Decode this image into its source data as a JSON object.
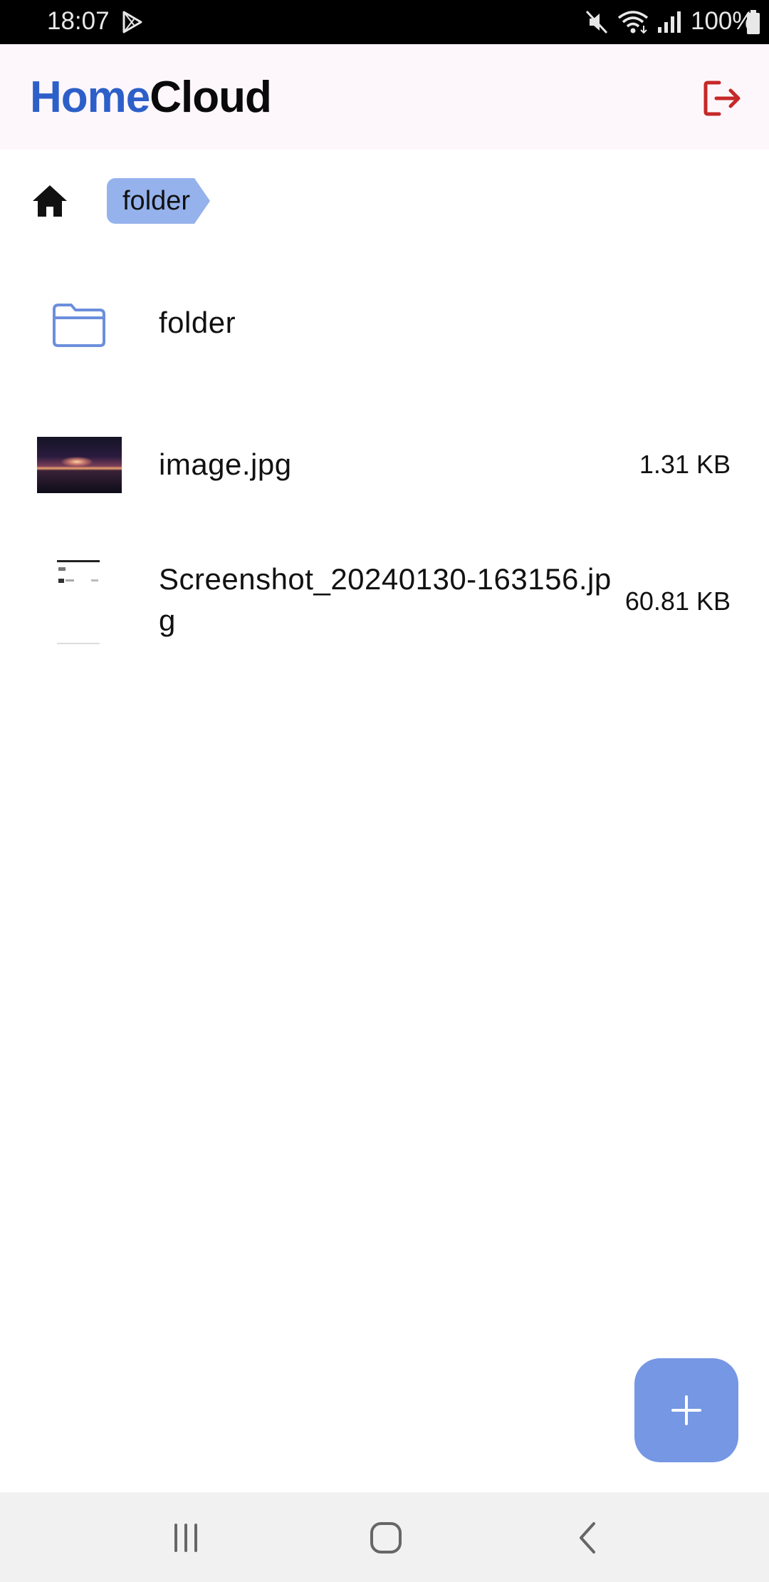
{
  "status_bar": {
    "time": "18:07",
    "battery_percent": "100%",
    "icons": [
      "play-store-icon",
      "mute-icon",
      "wifi-icon",
      "signal-icon",
      "battery-icon"
    ]
  },
  "app_bar": {
    "brand_home": "Home",
    "brand_cloud": "Cloud",
    "logout_icon": "logout-icon",
    "colors": {
      "brand_home": "#2d5fc9",
      "logout": "#c62828"
    }
  },
  "breadcrumb": {
    "home_icon": "home-icon",
    "current": "folder"
  },
  "files": [
    {
      "type": "folder",
      "name": "folder",
      "size": ""
    },
    {
      "type": "image",
      "name": "image.jpg",
      "size": "1.31 KB"
    },
    {
      "type": "image",
      "name": "Screenshot_20240130-163156.jpg",
      "size": "60.81 KB"
    }
  ],
  "fab": {
    "icon": "plus-icon",
    "color": "#7597e4"
  },
  "nav_bar": {
    "icons": [
      "recent-apps-icon",
      "home-nav-icon",
      "back-icon"
    ]
  }
}
